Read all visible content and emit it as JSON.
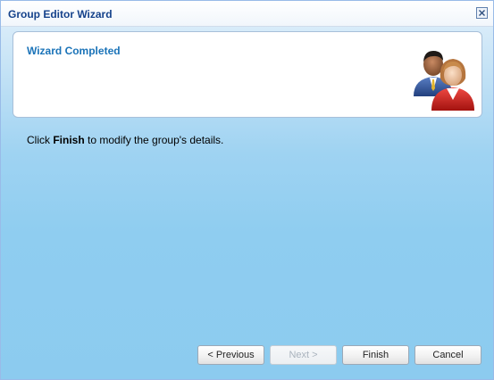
{
  "window": {
    "title": "Group Editor Wizard"
  },
  "header": {
    "title": "Wizard Completed",
    "illustration_icon": "group-users-icon"
  },
  "body": {
    "text_before": "Click ",
    "text_bold": "Finish",
    "text_after": " to modify the group's details."
  },
  "buttons": {
    "previous": "< Previous",
    "next": "Next >",
    "finish": "Finish",
    "cancel": "Cancel"
  },
  "colors": {
    "title_text": "#15428b",
    "header_title": "#1a73b8",
    "window_background": "#8ccbef"
  }
}
